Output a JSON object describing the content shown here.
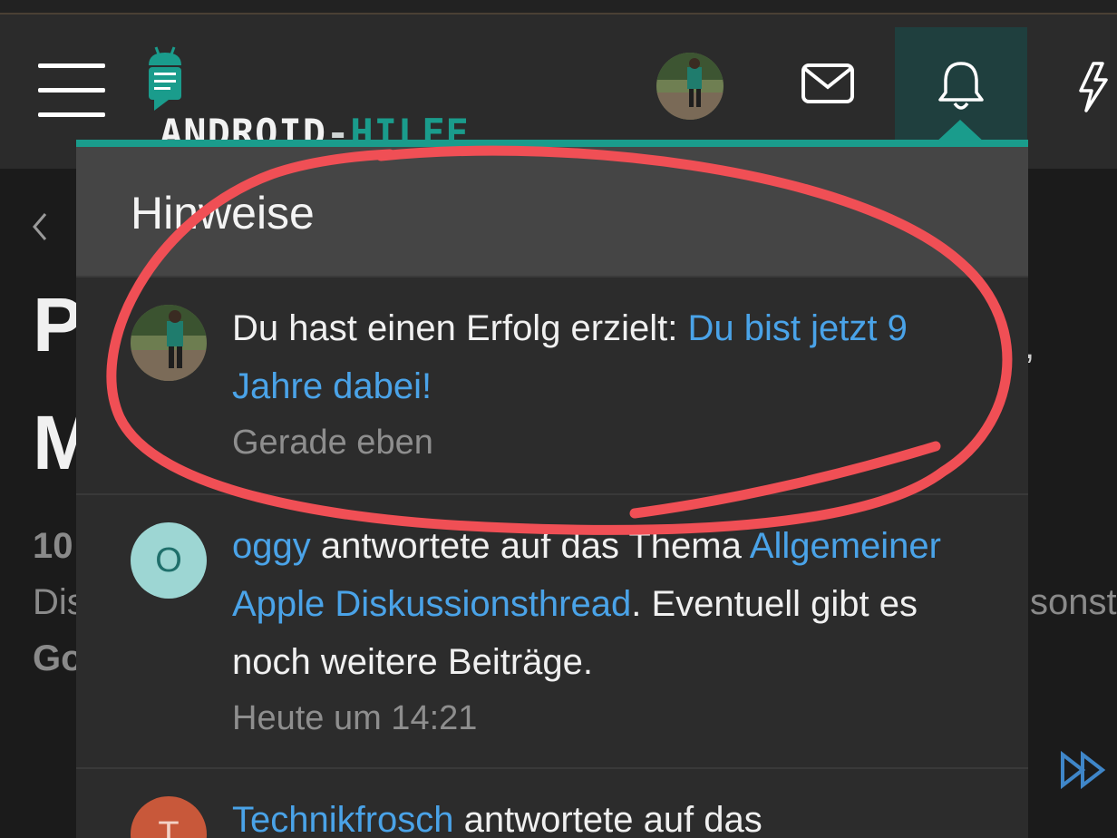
{
  "site": {
    "logo_part1": "ANDROID",
    "logo_dash": "-",
    "logo_part2": "HILFE"
  },
  "header": {
    "menu_icon": "hamburger-icon",
    "mail_icon": "envelope-icon",
    "bell_icon": "bell-icon",
    "bolt_icon": "lightning-icon"
  },
  "background": {
    "frag1": "P",
    "frag2": "M",
    "frag3": "10",
    "frag4": "Dis",
    "frag5": "Go",
    "frag6": "sonst",
    "frag7": ","
  },
  "panel": {
    "title": "Hinweise",
    "notifications": [
      {
        "text": "Du hast einen Erfolg erzielt: ",
        "link": "Du bist jetzt 9 Jahre dabei!",
        "time": "Gerade eben"
      },
      {
        "avatar_letter": "O",
        "user": "oggy",
        "text": " antwortete auf das Thema ",
        "thread": "Allgemeiner Apple Diskussionsthread",
        "after": ". Eventuell gibt es noch weitere Beiträge.",
        "time": "Heute um 14:21"
      },
      {
        "avatar_letter": "T",
        "user": "Technikfrosch",
        "text": " antwortete auf das"
      }
    ]
  },
  "colors": {
    "accent": "#1a9c8c",
    "link": "#4aa3e8",
    "annotation": "#f04f55"
  }
}
